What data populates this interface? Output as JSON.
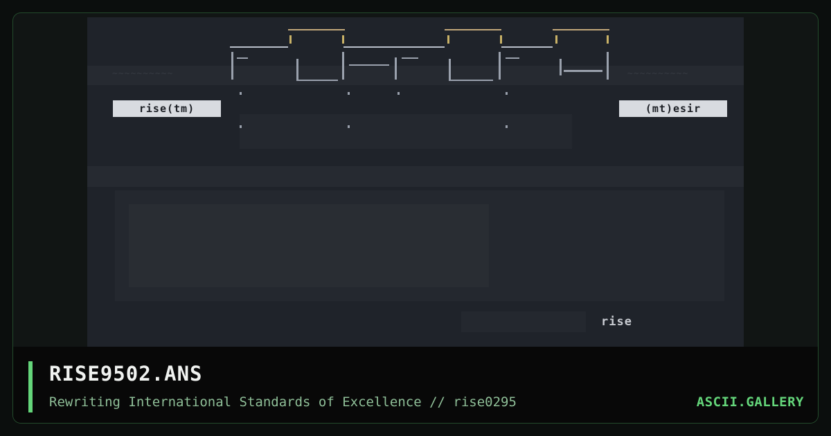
{
  "artwork": {
    "label_left": "rise(tm)",
    "label_right": "(mt)esir",
    "signature": "rise"
  },
  "info": {
    "title": "RISE9502.ANS",
    "subtitle": "Rewriting International Standards of Excellence // rise0295",
    "brand": "ASCII.GALLERY"
  },
  "colors": {
    "accent": "#64d57a",
    "preview_bg": "#1f232a",
    "logo_gold": "#c2a77a"
  }
}
